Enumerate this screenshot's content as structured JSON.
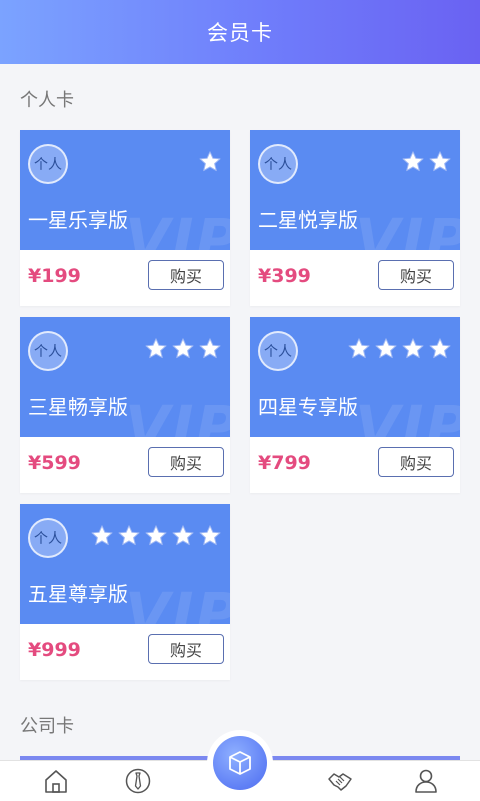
{
  "header": {
    "title": "会员卡"
  },
  "sections": {
    "personal": "个人卡",
    "company": "公司卡"
  },
  "badge_label": "个人",
  "buy_label": "购买",
  "watermark": "VIP",
  "cards": [
    {
      "name": "一星乐享版",
      "price": "¥199",
      "stars": 1
    },
    {
      "name": "二星悦享版",
      "price": "¥399",
      "stars": 2
    },
    {
      "name": "三星畅享版",
      "price": "¥599",
      "stars": 3
    },
    {
      "name": "四星专享版",
      "price": "¥799",
      "stars": 4
    },
    {
      "name": "五星尊享版",
      "price": "¥999",
      "stars": 5
    }
  ],
  "tabbar": {
    "icons": [
      "home-icon",
      "tie-icon",
      "cube-icon",
      "handshake-icon",
      "user-icon"
    ]
  },
  "colors": {
    "header_start": "#7ba3ff",
    "header_end": "#6a62f2",
    "card_blue": "#5a8bf2",
    "price_pink": "#e44b7f"
  }
}
